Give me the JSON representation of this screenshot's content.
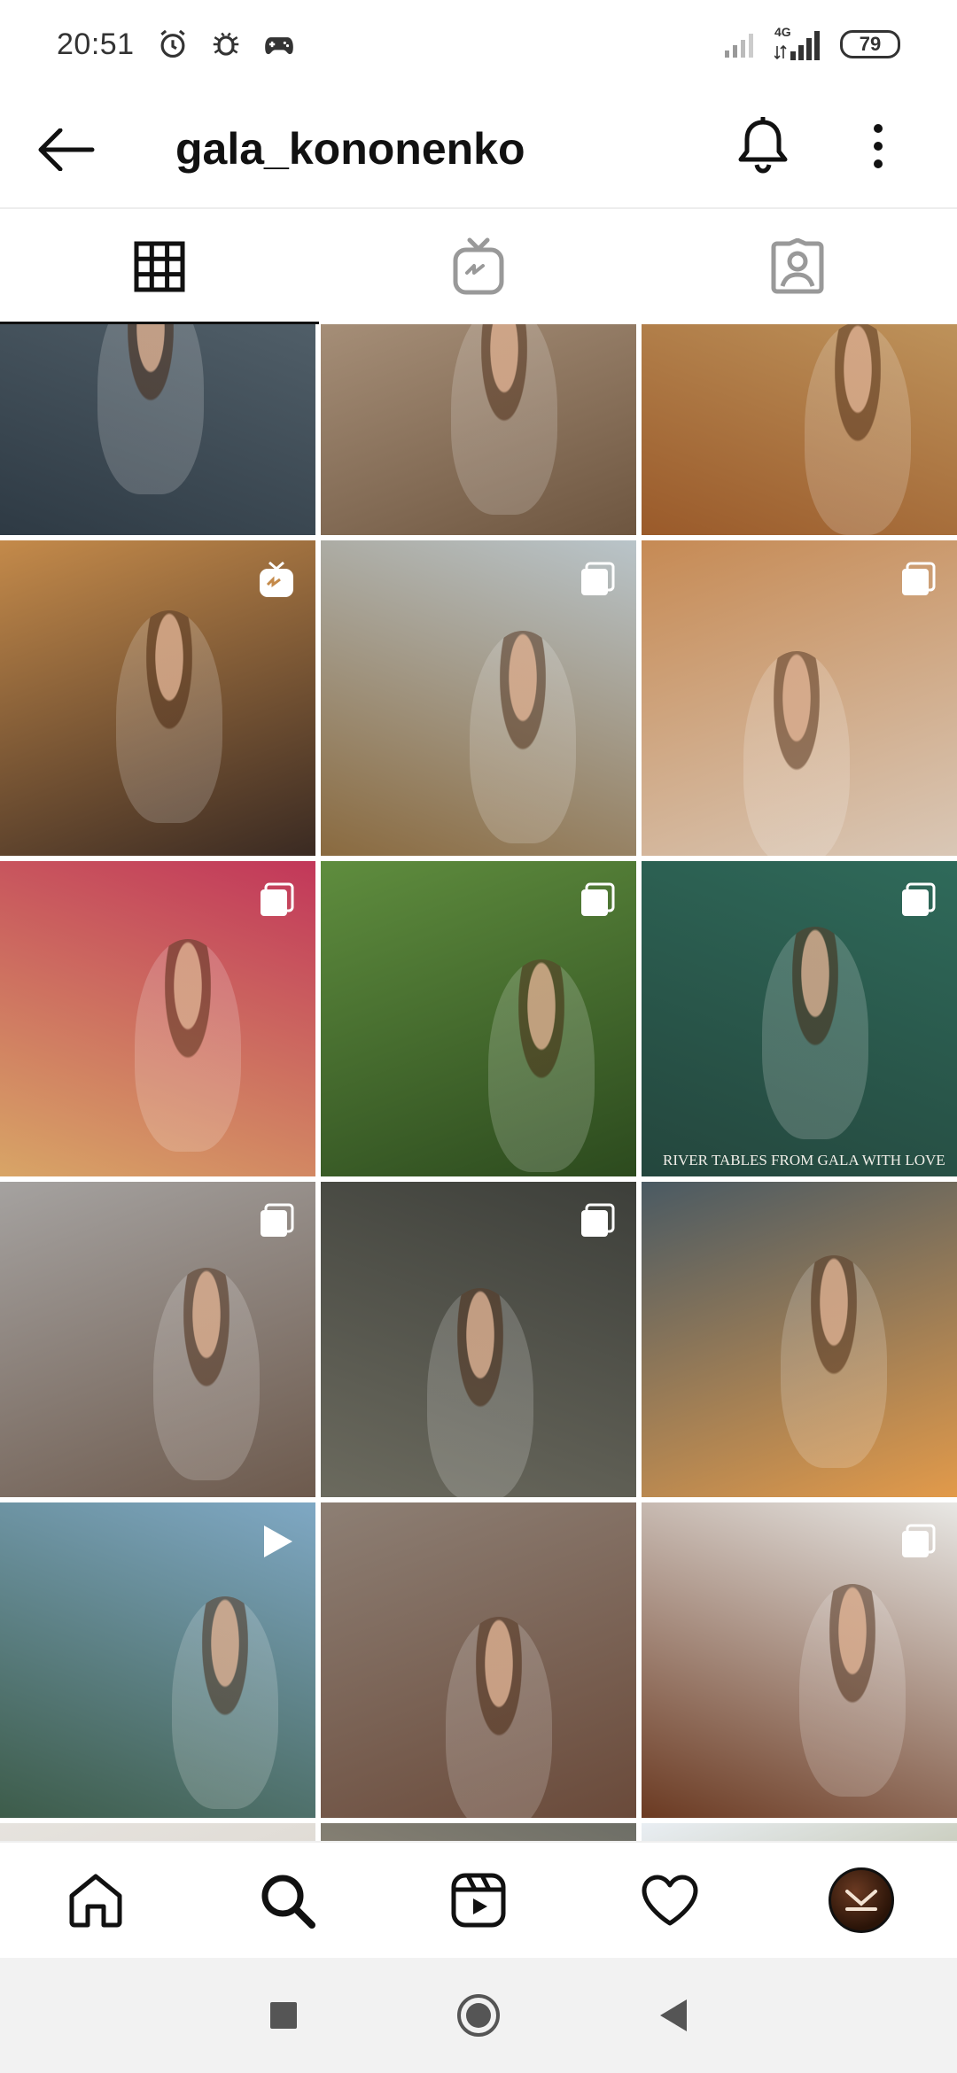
{
  "status_bar": {
    "time": "20:51",
    "network": "4G",
    "battery": "79",
    "icons": [
      "alarm-icon",
      "bug-icon",
      "gamepad-icon",
      "signal-icon",
      "signal-4g-icon",
      "battery-icon"
    ]
  },
  "header": {
    "title": "gala_kononenko",
    "icons": [
      "back-arrow-icon",
      "bell-icon",
      "more-vertical-icon"
    ]
  },
  "tabs": [
    {
      "name": "posts-grid",
      "icon": "grid-icon",
      "active": true
    },
    {
      "name": "igtv",
      "icon": "igtv-icon",
      "active": false
    },
    {
      "name": "tagged",
      "icon": "tagged-user-icon",
      "active": false
    }
  ],
  "grid": {
    "tiles": [
      {
        "kind": "none",
        "colors": [
          "#5b6a74",
          "#2e3a44"
        ]
      },
      {
        "kind": "none",
        "colors": [
          "#b7a089",
          "#6e5640"
        ]
      },
      {
        "kind": "none",
        "colors": [
          "#c9a46a",
          "#9a5a2a"
        ]
      },
      {
        "kind": "igtv",
        "colors": [
          "#c48a4a",
          "#3a2a22"
        ]
      },
      {
        "kind": "carousel",
        "colors": [
          "#b9c4c9",
          "#8a6a3f"
        ]
      },
      {
        "kind": "carousel",
        "colors": [
          "#c68a54",
          "#d9c7b6"
        ]
      },
      {
        "kind": "carousel",
        "colors": [
          "#c2375a",
          "#d8a566"
        ]
      },
      {
        "kind": "carousel",
        "colors": [
          "#5f8d3e",
          "#2c4a1e"
        ]
      },
      {
        "kind": "carousel",
        "colors": [
          "#2f6a5a",
          "#24463d"
        ]
      },
      {
        "kind": "carousel",
        "colors": [
          "#a5a2a0",
          "#6d5a4d"
        ]
      },
      {
        "kind": "carousel",
        "colors": [
          "#3d3f3a",
          "#6b6a5e"
        ]
      },
      {
        "kind": "none",
        "colors": [
          "#4a5a63",
          "#e29a4a"
        ]
      },
      {
        "kind": "video",
        "colors": [
          "#7fa8c4",
          "#3d5c4a"
        ]
      },
      {
        "kind": "none",
        "colors": [
          "#8d7f74",
          "#6a4a3a"
        ]
      },
      {
        "kind": "carousel",
        "colors": [
          "#e8e7e4",
          "#6b3a22"
        ]
      },
      {
        "kind": "igtv",
        "colors": [
          "#e6e3de",
          "#d4cdc4"
        ]
      },
      {
        "kind": "carousel",
        "colors": [
          "#6d6e66",
          "#b9a58f"
        ]
      },
      {
        "kind": "carousel",
        "colors": [
          "#e9eef3",
          "#8a8a52"
        ]
      }
    ],
    "overlay_text": "RIVER TABLES FROM GALA WITH LOVE"
  },
  "bottom_nav": [
    {
      "name": "home",
      "icon": "home-icon"
    },
    {
      "name": "search",
      "icon": "search-icon"
    },
    {
      "name": "reels",
      "icon": "reels-icon"
    },
    {
      "name": "activity",
      "icon": "heart-icon"
    },
    {
      "name": "profile",
      "icon": "avatar-icon"
    }
  ],
  "system_nav": [
    "recents-square-icon",
    "home-circle-icon",
    "back-triangle-icon"
  ]
}
